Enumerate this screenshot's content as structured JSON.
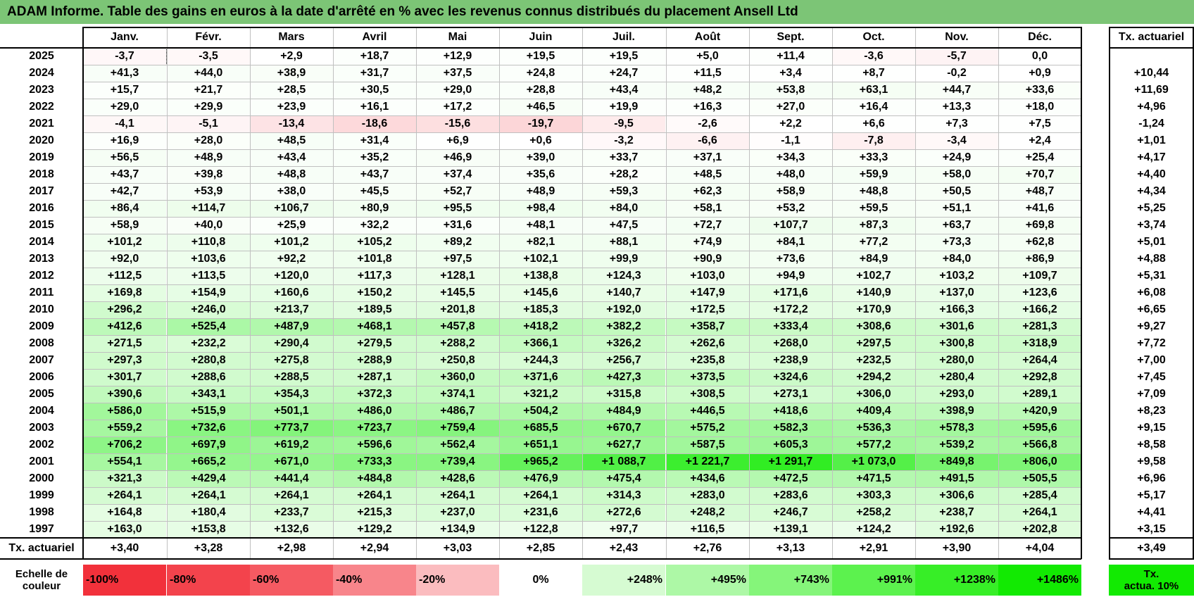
{
  "title": "ADAM Informe. Table des gains en euros à la date d'arrêté en % avec les revenus connus distribués du placement Ansell Ltd",
  "months": [
    "Janv.",
    "Févr.",
    "Mars",
    "Avril",
    "Mai",
    "Juin",
    "Juil.",
    "Août",
    "Sept.",
    "Oct.",
    "Nov.",
    "Déc."
  ],
  "rate_header": "Tx. actuariel",
  "rows": [
    {
      "year": "2025",
      "values": [
        "-3,7",
        "-3,5",
        "+2,9",
        "+18,7",
        "+12,9",
        "+19,5",
        "+19,5",
        "+5,0",
        "+11,4",
        "-3,6",
        "-5,7",
        "0,0"
      ],
      "rate": ""
    },
    {
      "year": "2024",
      "values": [
        "+41,3",
        "+44,0",
        "+38,9",
        "+31,7",
        "+37,5",
        "+24,8",
        "+24,7",
        "+11,5",
        "+3,4",
        "+8,7",
        "-0,2",
        "+0,9"
      ],
      "rate": "+10,44"
    },
    {
      "year": "2023",
      "values": [
        "+15,7",
        "+21,7",
        "+28,5",
        "+30,5",
        "+29,0",
        "+28,8",
        "+43,4",
        "+48,2",
        "+53,8",
        "+63,1",
        "+44,7",
        "+33,6"
      ],
      "rate": "+11,69"
    },
    {
      "year": "2022",
      "values": [
        "+29,0",
        "+29,9",
        "+23,9",
        "+16,1",
        "+17,2",
        "+46,5",
        "+19,9",
        "+16,3",
        "+27,0",
        "+16,4",
        "+13,3",
        "+18,0"
      ],
      "rate": "+4,96"
    },
    {
      "year": "2021",
      "values": [
        "-4,1",
        "-5,1",
        "-13,4",
        "-18,6",
        "-15,6",
        "-19,7",
        "-9,5",
        "-2,6",
        "+2,2",
        "+6,6",
        "+7,3",
        "+7,5"
      ],
      "rate": "-1,24"
    },
    {
      "year": "2020",
      "values": [
        "+16,9",
        "+28,0",
        "+48,5",
        "+31,4",
        "+6,9",
        "+0,6",
        "-3,2",
        "-6,6",
        "-1,1",
        "-7,8",
        "-3,4",
        "+2,4"
      ],
      "rate": "+1,01"
    },
    {
      "year": "2019",
      "values": [
        "+56,5",
        "+48,9",
        "+43,4",
        "+35,2",
        "+46,9",
        "+39,0",
        "+33,7",
        "+37,1",
        "+34,3",
        "+33,3",
        "+24,9",
        "+25,4"
      ],
      "rate": "+4,17"
    },
    {
      "year": "2018",
      "values": [
        "+43,7",
        "+39,8",
        "+48,8",
        "+43,7",
        "+37,4",
        "+35,6",
        "+28,2",
        "+48,5",
        "+48,0",
        "+59,9",
        "+58,0",
        "+70,7"
      ],
      "rate": "+4,40"
    },
    {
      "year": "2017",
      "values": [
        "+42,7",
        "+53,9",
        "+38,0",
        "+45,5",
        "+52,7",
        "+48,9",
        "+59,3",
        "+62,3",
        "+58,9",
        "+48,8",
        "+50,5",
        "+48,7"
      ],
      "rate": "+4,34"
    },
    {
      "year": "2016",
      "values": [
        "+86,4",
        "+114,7",
        "+106,7",
        "+80,9",
        "+95,5",
        "+98,4",
        "+84,0",
        "+58,1",
        "+53,2",
        "+59,5",
        "+51,1",
        "+41,6"
      ],
      "rate": "+5,25"
    },
    {
      "year": "2015",
      "values": [
        "+58,9",
        "+40,0",
        "+25,9",
        "+32,2",
        "+31,6",
        "+48,1",
        "+47,5",
        "+72,7",
        "+107,7",
        "+87,3",
        "+63,7",
        "+69,8"
      ],
      "rate": "+3,74"
    },
    {
      "year": "2014",
      "values": [
        "+101,2",
        "+110,8",
        "+101,2",
        "+105,2",
        "+89,2",
        "+82,1",
        "+88,1",
        "+74,9",
        "+84,1",
        "+77,2",
        "+73,3",
        "+62,8"
      ],
      "rate": "+5,01"
    },
    {
      "year": "2013",
      "values": [
        "+92,0",
        "+103,6",
        "+92,2",
        "+101,8",
        "+97,5",
        "+102,1",
        "+99,9",
        "+90,9",
        "+73,6",
        "+84,9",
        "+84,0",
        "+86,9"
      ],
      "rate": "+4,88"
    },
    {
      "year": "2012",
      "values": [
        "+112,5",
        "+113,5",
        "+120,0",
        "+117,3",
        "+128,1",
        "+138,8",
        "+124,3",
        "+103,0",
        "+94,9",
        "+102,7",
        "+103,2",
        "+109,7"
      ],
      "rate": "+5,31"
    },
    {
      "year": "2011",
      "values": [
        "+169,8",
        "+154,9",
        "+160,6",
        "+150,2",
        "+145,5",
        "+145,6",
        "+140,7",
        "+147,9",
        "+171,6",
        "+140,9",
        "+137,0",
        "+123,6"
      ],
      "rate": "+6,08"
    },
    {
      "year": "2010",
      "values": [
        "+296,2",
        "+246,0",
        "+213,7",
        "+189,5",
        "+201,8",
        "+185,3",
        "+192,0",
        "+172,5",
        "+172,2",
        "+170,9",
        "+166,3",
        "+166,2"
      ],
      "rate": "+6,65"
    },
    {
      "year": "2009",
      "values": [
        "+412,6",
        "+525,4",
        "+487,9",
        "+468,1",
        "+457,8",
        "+418,2",
        "+382,2",
        "+358,7",
        "+333,4",
        "+308,6",
        "+301,6",
        "+281,3"
      ],
      "rate": "+9,27"
    },
    {
      "year": "2008",
      "values": [
        "+271,5",
        "+232,2",
        "+290,4",
        "+279,5",
        "+288,2",
        "+366,1",
        "+326,2",
        "+262,6",
        "+268,0",
        "+297,5",
        "+300,8",
        "+318,9"
      ],
      "rate": "+7,72"
    },
    {
      "year": "2007",
      "values": [
        "+297,3",
        "+280,8",
        "+275,8",
        "+288,9",
        "+250,8",
        "+244,3",
        "+256,7",
        "+235,8",
        "+238,9",
        "+232,5",
        "+280,0",
        "+264,4"
      ],
      "rate": "+7,00"
    },
    {
      "year": "2006",
      "values": [
        "+301,7",
        "+288,6",
        "+288,5",
        "+287,1",
        "+360,0",
        "+371,6",
        "+427,3",
        "+373,5",
        "+324,6",
        "+294,2",
        "+280,4",
        "+292,8"
      ],
      "rate": "+7,45"
    },
    {
      "year": "2005",
      "values": [
        "+390,6",
        "+343,1",
        "+354,3",
        "+372,3",
        "+374,1",
        "+321,2",
        "+315,8",
        "+308,5",
        "+273,1",
        "+306,0",
        "+293,0",
        "+289,1"
      ],
      "rate": "+7,09"
    },
    {
      "year": "2004",
      "values": [
        "+586,0",
        "+515,9",
        "+501,1",
        "+486,0",
        "+486,7",
        "+504,2",
        "+484,9",
        "+446,5",
        "+418,6",
        "+409,4",
        "+398,9",
        "+420,9"
      ],
      "rate": "+8,23"
    },
    {
      "year": "2003",
      "values": [
        "+559,2",
        "+732,6",
        "+773,7",
        "+723,7",
        "+759,4",
        "+685,5",
        "+670,7",
        "+575,2",
        "+582,3",
        "+536,3",
        "+578,3",
        "+595,6"
      ],
      "rate": "+9,15"
    },
    {
      "year": "2002",
      "values": [
        "+706,2",
        "+697,9",
        "+619,2",
        "+596,6",
        "+562,4",
        "+651,1",
        "+627,7",
        "+587,5",
        "+605,3",
        "+577,2",
        "+539,2",
        "+566,8"
      ],
      "rate": "+8,58"
    },
    {
      "year": "2001",
      "values": [
        "+554,1",
        "+665,2",
        "+671,0",
        "+733,3",
        "+739,4",
        "+965,2",
        "+1 088,7",
        "+1 221,7",
        "+1 291,7",
        "+1 073,0",
        "+849,8",
        "+806,0"
      ],
      "rate": "+9,58"
    },
    {
      "year": "2000",
      "values": [
        "+321,3",
        "+429,4",
        "+441,4",
        "+484,8",
        "+428,6",
        "+476,9",
        "+475,4",
        "+434,6",
        "+472,5",
        "+471,5",
        "+491,5",
        "+505,5"
      ],
      "rate": "+6,96"
    },
    {
      "year": "1999",
      "values": [
        "+264,1",
        "+264,1",
        "+264,1",
        "+264,1",
        "+264,1",
        "+264,1",
        "+314,3",
        "+283,0",
        "+283,6",
        "+303,3",
        "+306,6",
        "+285,4"
      ],
      "rate": "+5,17"
    },
    {
      "year": "1998",
      "values": [
        "+164,8",
        "+180,4",
        "+233,7",
        "+215,3",
        "+237,0",
        "+231,6",
        "+272,6",
        "+248,2",
        "+246,7",
        "+258,2",
        "+238,7",
        "+264,1"
      ],
      "rate": "+4,41"
    },
    {
      "year": "1997",
      "values": [
        "+163,0",
        "+153,8",
        "+132,6",
        "+129,2",
        "+134,9",
        "+122,8",
        "+97,7",
        "+116,5",
        "+139,1",
        "+124,2",
        "+192,6",
        "+202,8"
      ],
      "rate": "+3,15"
    }
  ],
  "footer": {
    "label": "Tx. actuariel",
    "values": [
      "+3,40",
      "+3,28",
      "+2,98",
      "+2,94",
      "+3,03",
      "+2,85",
      "+2,43",
      "+2,76",
      "+3,13",
      "+2,91",
      "+3,90",
      "+4,04"
    ],
    "rate": "+3,49"
  },
  "legend": {
    "label_line1": "Echelle de",
    "label_line2": "couleur",
    "items": [
      {
        "text": "-100%",
        "color": "#f2313b",
        "align": "left"
      },
      {
        "text": "-80%",
        "color": "#f3434c",
        "align": "left"
      },
      {
        "text": "-60%",
        "color": "#f55a62",
        "align": "left"
      },
      {
        "text": "-40%",
        "color": "#f8858b",
        "align": "left"
      },
      {
        "text": "-20%",
        "color": "#fbbcbf",
        "align": "left"
      },
      {
        "text": "0%",
        "color": "#ffffff",
        "align": "center"
      },
      {
        "text": "+248%",
        "color": "#d6fbd2",
        "align": "right"
      },
      {
        "text": "+495%",
        "color": "#adf8a6",
        "align": "right"
      },
      {
        "text": "+743%",
        "color": "#85f57a",
        "align": "right"
      },
      {
        "text": "+991%",
        "color": "#5cf24e",
        "align": "right"
      },
      {
        "text": "+1238%",
        "color": "#37ee27",
        "align": "right"
      },
      {
        "text": "+1486%",
        "color": "#12ea02",
        "align": "right"
      }
    ],
    "rate_line1": "Tx.",
    "rate_line2": "actua. 10%",
    "rate_color": "#12ea02"
  },
  "colors": {
    "title_bg": "#7cc576",
    "positive_max": "#12ea02",
    "negative_max": "#f2313b"
  }
}
